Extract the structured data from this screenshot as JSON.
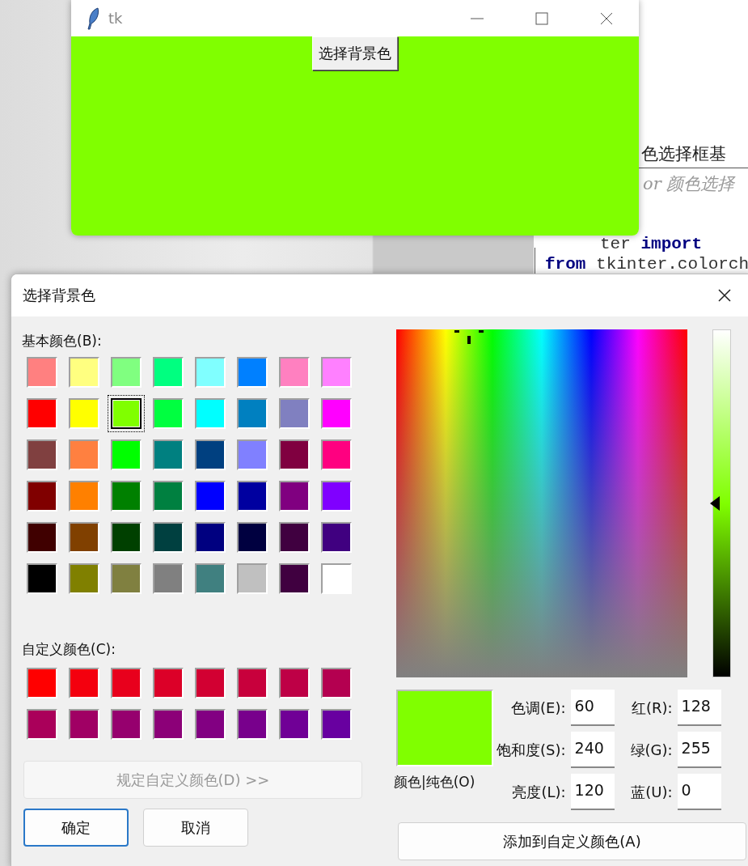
{
  "document": {
    "heading": "色选择框基",
    "subheading": "or 颜色选择",
    "code_lines": [
      "ter **import**",
      "**from** tkinter.colorch"
    ]
  },
  "tk_window": {
    "title": "tk",
    "button": "选择背景色"
  },
  "dialog": {
    "title": "选择背景色",
    "basic_label": "基本颜色(B):",
    "basic_colors": [
      {
        "color": "#ff8080",
        "selected": false
      },
      {
        "color": "#ffff80",
        "selected": false
      },
      {
        "color": "#80ff80",
        "selected": false
      },
      {
        "color": "#00ff80",
        "selected": false
      },
      {
        "color": "#80ffff",
        "selected": false
      },
      {
        "color": "#0080ff",
        "selected": false
      },
      {
        "color": "#ff80c0",
        "selected": false
      },
      {
        "color": "#ff80ff",
        "selected": false
      },
      {
        "color": "#ff0000",
        "selected": false
      },
      {
        "color": "#ffff00",
        "selected": false
      },
      {
        "color": "#80ff00",
        "selected": true
      },
      {
        "color": "#00ff40",
        "selected": false
      },
      {
        "color": "#00ffff",
        "selected": false
      },
      {
        "color": "#0080c0",
        "selected": false
      },
      {
        "color": "#8080c0",
        "selected": false
      },
      {
        "color": "#ff00ff",
        "selected": false
      },
      {
        "color": "#804040",
        "selected": false
      },
      {
        "color": "#ff8040",
        "selected": false
      },
      {
        "color": "#00ff00",
        "selected": false
      },
      {
        "color": "#008080",
        "selected": false
      },
      {
        "color": "#004080",
        "selected": false
      },
      {
        "color": "#8080ff",
        "selected": false
      },
      {
        "color": "#800040",
        "selected": false
      },
      {
        "color": "#ff0080",
        "selected": false
      },
      {
        "color": "#800000",
        "selected": false
      },
      {
        "color": "#ff8000",
        "selected": false
      },
      {
        "color": "#008000",
        "selected": false
      },
      {
        "color": "#008040",
        "selected": false
      },
      {
        "color": "#0000ff",
        "selected": false
      },
      {
        "color": "#0000a0",
        "selected": false
      },
      {
        "color": "#800080",
        "selected": false
      },
      {
        "color": "#8000ff",
        "selected": false
      },
      {
        "color": "#400000",
        "selected": false
      },
      {
        "color": "#804000",
        "selected": false
      },
      {
        "color": "#004000",
        "selected": false
      },
      {
        "color": "#004040",
        "selected": false
      },
      {
        "color": "#000080",
        "selected": false
      },
      {
        "color": "#000040",
        "selected": false
      },
      {
        "color": "#400040",
        "selected": false
      },
      {
        "color": "#400080",
        "selected": false
      },
      {
        "color": "#000000",
        "selected": false
      },
      {
        "color": "#808000",
        "selected": false
      },
      {
        "color": "#808040",
        "selected": false
      },
      {
        "color": "#808080",
        "selected": false
      },
      {
        "color": "#408080",
        "selected": false
      },
      {
        "color": "#c0c0c0",
        "selected": false
      },
      {
        "color": "#400040",
        "selected": false
      },
      {
        "color": "#ffffff",
        "selected": false
      }
    ],
    "custom_label": "自定义颜色(C):",
    "custom_colors": [
      {
        "color": "#ff0000"
      },
      {
        "color": "#f4000e"
      },
      {
        "color": "#e8001c"
      },
      {
        "color": "#dc0028"
      },
      {
        "color": "#d20032"
      },
      {
        "color": "#c8003c"
      },
      {
        "color": "#be0046"
      },
      {
        "color": "#b40050"
      },
      {
        "color": "#aa005a"
      },
      {
        "color": "#a00064"
      },
      {
        "color": "#96006e"
      },
      {
        "color": "#8c0078"
      },
      {
        "color": "#820082"
      },
      {
        "color": "#78008c"
      },
      {
        "color": "#700096"
      },
      {
        "color": "#6800a0"
      }
    ],
    "define_button": {
      "label": "规定自定义颜色(D) >>",
      "disabled": true
    },
    "ok_button": "确定",
    "cancel_button": "取消",
    "luminance": {
      "level": 0.5
    },
    "preview_label": "颜色|纯色(O)",
    "hsl_fields": [
      {
        "label": "色调(E):",
        "value": "60"
      },
      {
        "label": "饱和度(S):",
        "value": "240"
      },
      {
        "label": "亮度(L):",
        "value": "120"
      }
    ],
    "rgb_fields": [
      {
        "label": "红(R):",
        "value": "128"
      },
      {
        "label": "绿(G):",
        "value": "255"
      },
      {
        "label": "蓝(U):",
        "value": "0"
      }
    ],
    "add_button": "添加到自定义颜色(A)"
  }
}
